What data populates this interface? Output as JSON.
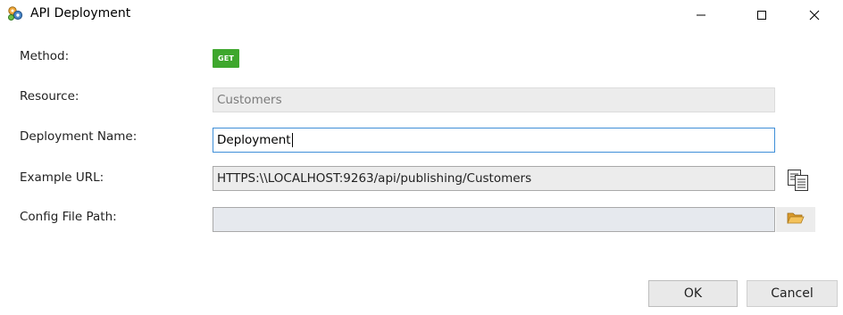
{
  "window": {
    "title": "API Deployment",
    "app_icon": "gear-cluster-icon"
  },
  "titlebar_controls": {
    "minimize_icon": "minimize-icon",
    "maximize_icon": "maximize-icon",
    "close_icon": "close-icon"
  },
  "form": {
    "method_label": "Method:",
    "method_value": "GET",
    "resource_label": "Resource:",
    "resource_value": "Customers",
    "deployment_name_label": "Deployment Name:",
    "deployment_name_value": "Deployment",
    "example_url_label": "Example URL:",
    "example_url_value": "HTTPS:\\\\LOCALHOST:9263/api/publishing/Customers",
    "copy_icon": "copy-icon",
    "config_path_label": "Config File Path:",
    "config_path_value": "",
    "browse_icon": "folder-open-icon"
  },
  "buttons": {
    "ok_label": "OK",
    "cancel_label": "Cancel"
  },
  "colors": {
    "method_badge": "#3ea72d",
    "focus_border": "#3f8fd8"
  }
}
